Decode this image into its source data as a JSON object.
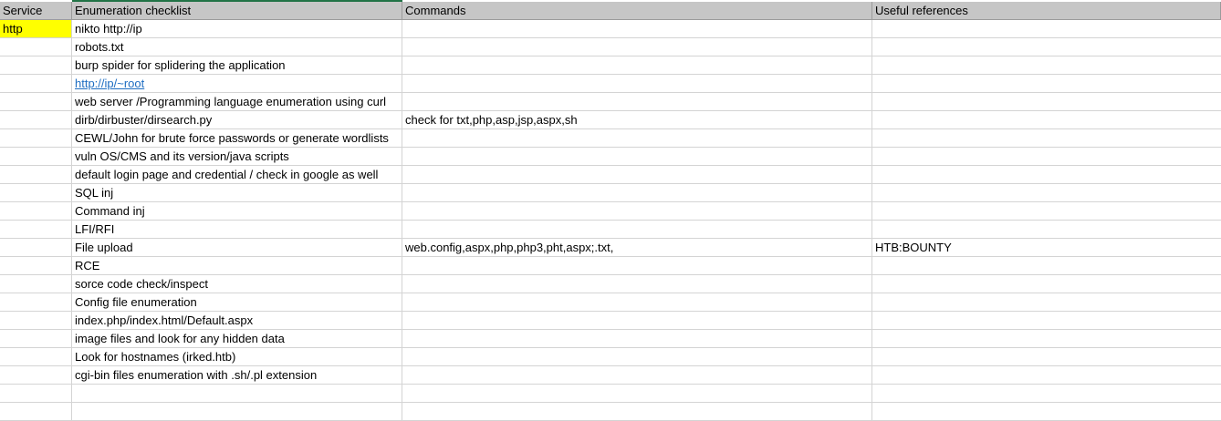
{
  "headers": [
    "Service",
    "Enumeration checklist",
    "Commands",
    "Useful references"
  ],
  "colors": {
    "highlight": "#ffff00",
    "link": "#1f6ec2",
    "header_bg": "#c6c6c6"
  },
  "rows": [
    [
      "http",
      "nikto http://ip",
      "",
      ""
    ],
    [
      "",
      "robots.txt",
      "",
      ""
    ],
    [
      "",
      "burp spider for splidering the application",
      "",
      ""
    ],
    [
      "",
      "http://ip/~root",
      "",
      ""
    ],
    [
      "",
      "web server /Programming language enumeration using curl",
      "",
      ""
    ],
    [
      "",
      "dirb/dirbuster/dirsearch.py",
      "check for txt,php,asp,jsp,aspx,sh",
      ""
    ],
    [
      "",
      "CEWL/John for brute force passwords or generate wordlists",
      "",
      ""
    ],
    [
      "",
      "vuln OS/CMS and its version/java scripts",
      "",
      ""
    ],
    [
      "",
      "default login page and credential / check in google as well",
      "",
      ""
    ],
    [
      "",
      "SQL inj",
      "",
      ""
    ],
    [
      "",
      "Command inj",
      "",
      ""
    ],
    [
      "",
      "LFI/RFI",
      "",
      ""
    ],
    [
      "",
      "File upload",
      "web.config,aspx,php,php3,pht,aspx;.txt,",
      "HTB:BOUNTY"
    ],
    [
      "",
      "RCE",
      "",
      ""
    ],
    [
      "",
      "sorce code check/inspect",
      "",
      ""
    ],
    [
      "",
      "Config file enumeration",
      "",
      ""
    ],
    [
      "",
      "index.php/index.html/Default.aspx",
      "",
      ""
    ],
    [
      "",
      "image files and look for any hidden data",
      "",
      ""
    ],
    [
      "",
      "Look for hostnames (irked.htb)",
      "",
      ""
    ],
    [
      "",
      "cgi-bin files enumeration with .sh/.pl extension",
      "",
      ""
    ],
    [
      "",
      "",
      "",
      ""
    ],
    [
      "",
      "",
      "",
      ""
    ]
  ]
}
